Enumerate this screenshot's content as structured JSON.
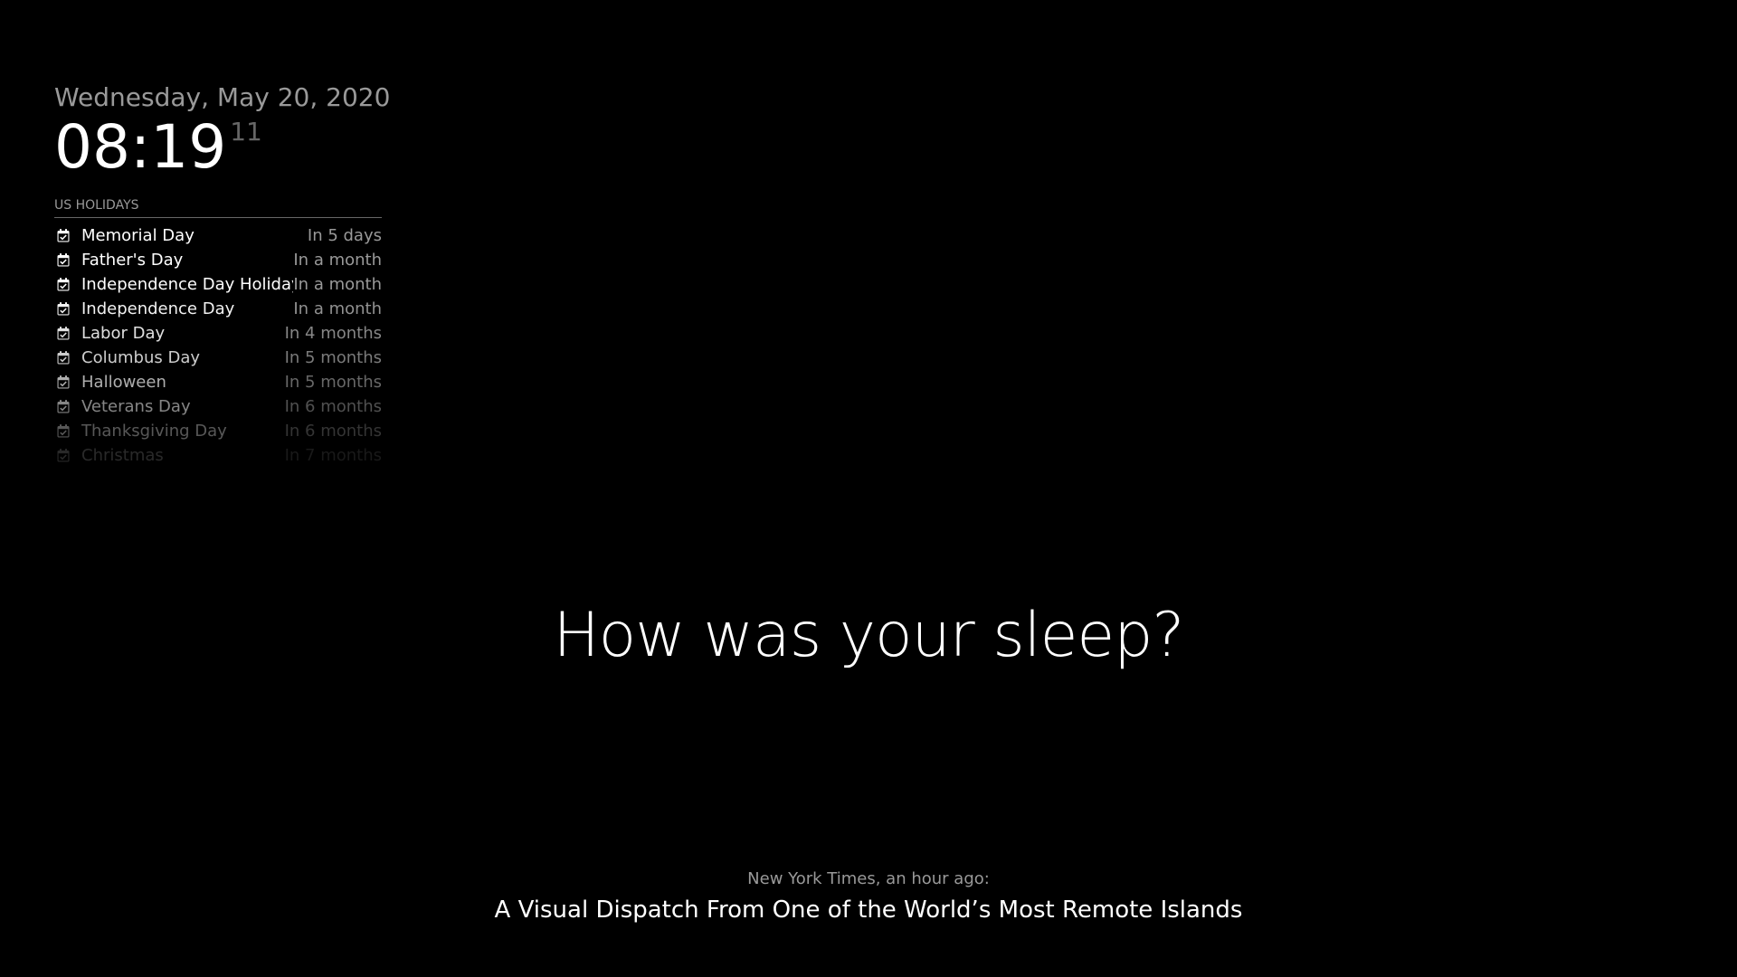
{
  "clock": {
    "date": "Wednesday, May 20, 2020",
    "time": "08:19",
    "seconds": "11"
  },
  "calendar": {
    "header": "US HOLIDAYS",
    "icon": "calendar-check-icon",
    "items": [
      {
        "title": "Memorial Day",
        "time": "In 5 days",
        "opacity": 1.0
      },
      {
        "title": "Father's Day",
        "time": "In a month",
        "opacity": 1.0
      },
      {
        "title": "Independence Day Holiday",
        "time": "In a month",
        "opacity": 1.0
      },
      {
        "title": "Independence Day",
        "time": "In a month",
        "opacity": 0.95
      },
      {
        "title": "Labor Day",
        "time": "In 4 months",
        "opacity": 0.88
      },
      {
        "title": "Columbus Day",
        "time": "In 5 months",
        "opacity": 0.8
      },
      {
        "title": "Halloween",
        "time": "In 5 months",
        "opacity": 0.68
      },
      {
        "title": "Veterans Day",
        "time": "In 6 months",
        "opacity": 0.52
      },
      {
        "title": "Thanksgiving Day",
        "time": "In 6 months",
        "opacity": 0.34
      },
      {
        "title": "Christmas",
        "time": "In 7 months",
        "opacity": 0.16
      }
    ]
  },
  "compliment": {
    "text": "How was your sleep?"
  },
  "news": {
    "source": "New York Times, an hour ago:",
    "headline": "A Visual Dispatch From One of the World’s Most Remote Islands"
  }
}
